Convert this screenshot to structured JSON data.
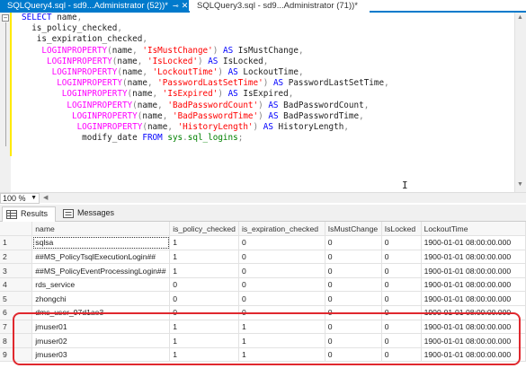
{
  "tabs": [
    {
      "label": "SQLQuery4.sql - sd9...Administrator (52))*",
      "active": true
    },
    {
      "label": "SQLQuery3.sql - sd9...Administrator (71))*",
      "active": false
    }
  ],
  "editor": {
    "zoom": "100 %"
  },
  "result_tabs": {
    "results": "Results",
    "messages": "Messages"
  },
  "grid": {
    "columns": [
      "name",
      "is_policy_checked",
      "is_expiration_checked",
      "IsMustChange",
      "IsLocked",
      "LockoutTime"
    ],
    "rows": [
      [
        "1",
        "sqlsa",
        "1",
        "0",
        "0",
        "0",
        "1900-01-01 08:00:00.000"
      ],
      [
        "2",
        "##MS_PolicyTsqlExecutionLogin##",
        "1",
        "0",
        "0",
        "0",
        "1900-01-01 08:00:00.000"
      ],
      [
        "3",
        "##MS_PolicyEventProcessingLogin##",
        "1",
        "0",
        "0",
        "0",
        "1900-01-01 08:00:00.000"
      ],
      [
        "4",
        "rds_service",
        "0",
        "0",
        "0",
        "0",
        "1900-01-01 08:00:00.000"
      ],
      [
        "5",
        "zhongchi",
        "0",
        "0",
        "0",
        "0",
        "1900-01-01 08:00:00.000"
      ],
      [
        "6",
        "dms_user_97d1ae3",
        "0",
        "0",
        "0",
        "0",
        "1900-01-01 08:00:00.000"
      ],
      [
        "7",
        "jmuser01",
        "1",
        "1",
        "0",
        "0",
        "1900-01-01 08:00:00.000"
      ],
      [
        "8",
        "jmuser02",
        "1",
        "1",
        "0",
        "0",
        "1900-01-01 08:00:00.000"
      ],
      [
        "9",
        "jmuser03",
        "1",
        "1",
        "0",
        "0",
        "1900-01-01 08:00:00.000"
      ]
    ]
  },
  "colors": {
    "accent": "#007acc",
    "highlight": "#e0282e"
  }
}
